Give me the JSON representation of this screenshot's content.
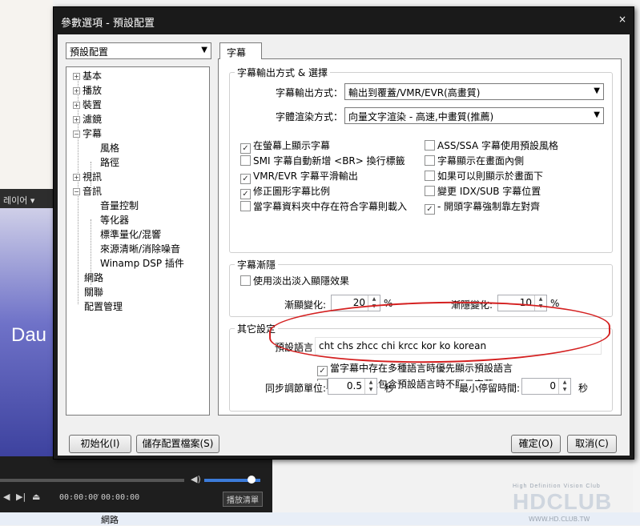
{
  "background": {
    "app_strip_label": "레이어 ▾",
    "video_text": "Dau",
    "player": {
      "time_current": "00:00:00",
      "time_total": "00:00:00",
      "playlist_button": "播放清單"
    },
    "taskbar_item": "網路",
    "logo": {
      "tagline": "High Definition Vision Club",
      "name": "HDCLUB",
      "url": "WWW.HD.CLUB.TW"
    }
  },
  "dialog": {
    "title": "參數選項 - 預設配置",
    "close_glyph": "×",
    "profile_combo": "預設配置",
    "tree": [
      {
        "label": "基本",
        "expander": "+"
      },
      {
        "label": "播放",
        "expander": "+"
      },
      {
        "label": "裝置",
        "expander": "+"
      },
      {
        "label": "濾鏡",
        "expander": "+"
      },
      {
        "label": "字幕",
        "expander": "−"
      },
      {
        "label": "風格",
        "expander": ""
      },
      {
        "label": "路徑",
        "expander": ""
      },
      {
        "label": "視訊",
        "expander": "+"
      },
      {
        "label": "音訊",
        "expander": "−"
      },
      {
        "label": "音量控制",
        "expander": ""
      },
      {
        "label": "等化器",
        "expander": ""
      },
      {
        "label": "標準量化/混響",
        "expander": ""
      },
      {
        "label": "來源清晰/消除噪音",
        "expander": ""
      },
      {
        "label": "Winamp DSP 插件",
        "expander": ""
      },
      {
        "label": "網路",
        "expander": ""
      },
      {
        "label": "關聯",
        "expander": ""
      },
      {
        "label": "配置管理",
        "expander": ""
      }
    ],
    "tab_label": "字幕",
    "output_group": {
      "title": "字幕輸出方式 & 選擇",
      "output_mode_label": "字幕輸出方式：",
      "output_mode_value": "輸出到覆蓋/VMR/EVR(高畫質)",
      "render_mode_label": "字體渲染方式：",
      "render_mode_value": "向量文字渲染 - 高速,中畫質(推薦)",
      "checkboxes": [
        {
          "label": "在螢幕上顯示字幕",
          "checked": true
        },
        {
          "label": "SMI 字幕自動新增 <BR> 換行標籤",
          "checked": false
        },
        {
          "label": "VMR/EVR 字幕平滑輸出",
          "checked": true
        },
        {
          "label": "修正圖形字幕比例",
          "checked": true
        },
        {
          "label": "當字幕資料夾中存在符合字幕則載入",
          "checked": false
        },
        {
          "label": "ASS/SSA 字幕使用預設風格",
          "checked": false
        },
        {
          "label": "字幕顯示在畫面內側",
          "checked": false
        },
        {
          "label": "如果可以則顯示於畫面下",
          "checked": false
        },
        {
          "label": "變更 IDX/SUB 字幕位置",
          "checked": false
        },
        {
          "label": "- 開頭字幕強制靠左對齊",
          "checked": true
        }
      ]
    },
    "fade_group": {
      "title": "字幕漸隱",
      "fade_checkbox": {
        "label": "使用淡出淡入顯隱效果",
        "checked": false
      },
      "fade_in_label": "漸顯變化:",
      "fade_in_value": "20",
      "fade_out_label": "漸隱變化:",
      "fade_out_value": "10",
      "unit": "%"
    },
    "other_group": {
      "title": "其它設定",
      "lang_label": "預設語言",
      "lang_value": "cht chs zhcc chi krcc kor ko korean",
      "cb_prefer": {
        "label": "當字幕中存在多種語言時優先顯示預設語言",
        "checked": true
      },
      "cb_hide": {
        "label": "當字幕中未包含預設語言時不顯示字幕",
        "checked": false
      },
      "annotation_color": "#d42020"
    },
    "sync_label": "同步調節單位:",
    "sync_value": "0.5",
    "sync_unit": "秒",
    "min_stay_label": "最小停留時間:",
    "min_stay_value": "0",
    "min_stay_unit": "秒",
    "buttons": {
      "reset": "初始化(I)",
      "save": "儲存配置檔案(S)",
      "ok": "確定(O)",
      "cancel": "取消(C)"
    }
  }
}
